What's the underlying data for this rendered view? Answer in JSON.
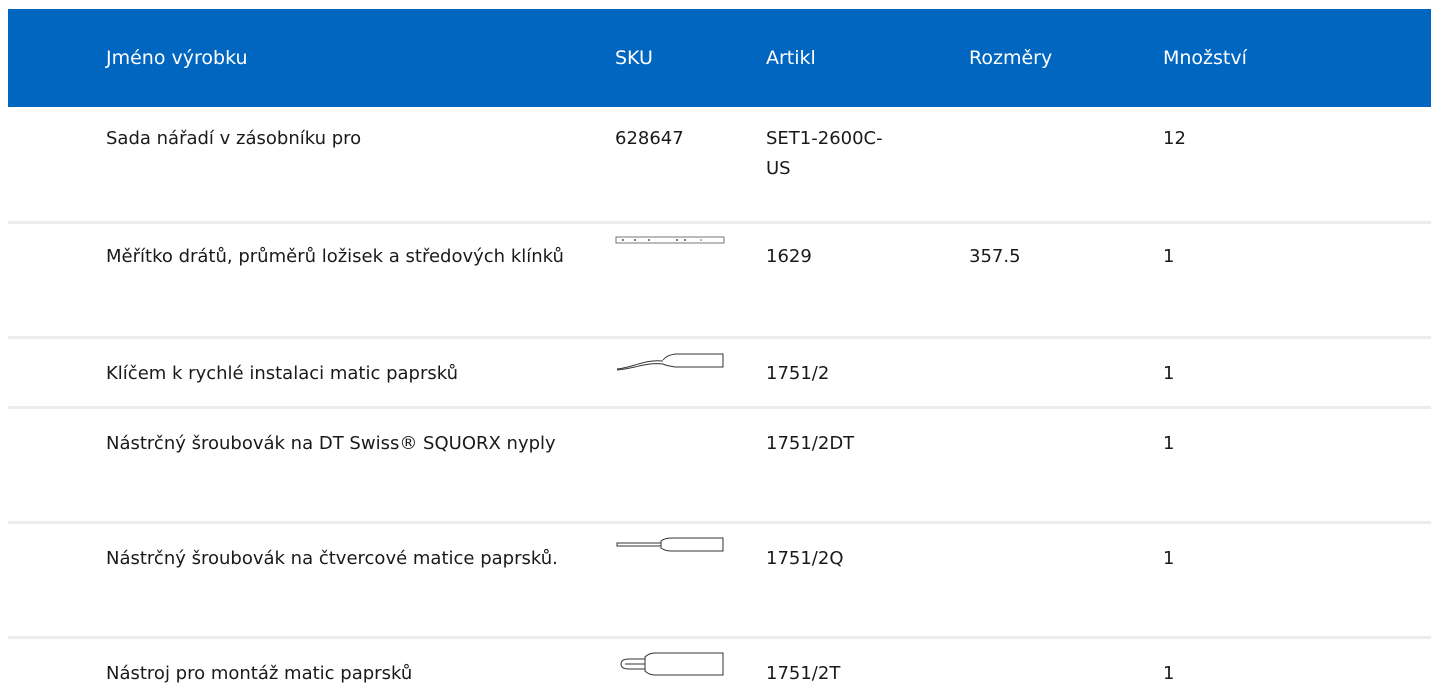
{
  "table": {
    "headers": {
      "name": "Jméno výrobku",
      "sku": "SKU",
      "article": "Artikl",
      "dimensions": "Rozměry",
      "quantity": "Množství"
    },
    "rows": [
      {
        "name": "Sada nářadí v zásobníku pro",
        "sku": "628647",
        "article": "SET1-2600C-US",
        "dimensions": "",
        "quantity": "12",
        "thumb": "none"
      },
      {
        "name": "Měřítko drátů, průměrů ložisek a středových klínků",
        "sku": "",
        "article": "1629",
        "dimensions": "357.5",
        "quantity": "1",
        "thumb": "ruler-icon"
      },
      {
        "name": "Klíčem k rychlé instalaci matic paprsků",
        "sku": "",
        "article": "1751/2",
        "dimensions": "",
        "quantity": "1",
        "thumb": "bent-screwdriver-icon"
      },
      {
        "name": "Nástrčný šroubovák na DT Swiss® SQUORX nyply",
        "sku": "",
        "article": "1751/2DT",
        "dimensions": "",
        "quantity": "1",
        "thumb": "none"
      },
      {
        "name": "Nástrčný šroubovák na čtvercové matice paprsků.",
        "sku": "",
        "article": "1751/2Q",
        "dimensions": "",
        "quantity": "1",
        "thumb": "screwdriver-icon"
      },
      {
        "name": "Nástroj pro montáž matic paprsků",
        "sku": "",
        "article": "1751/2T",
        "dimensions": "",
        "quantity": "1",
        "thumb": "nipple-tool-icon"
      }
    ]
  },
  "colors": {
    "header_bg": "#0066c0",
    "header_text": "#ffffff",
    "row_divider": "#ececec"
  }
}
